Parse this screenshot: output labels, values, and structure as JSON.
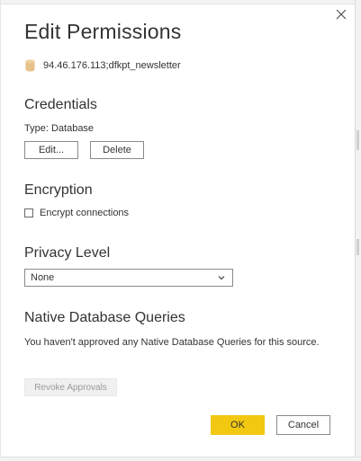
{
  "dialog": {
    "title": "Edit Permissions",
    "source_icon": "database-icon",
    "source_name": "94.46.176.113;dfkpt_newsletter",
    "close_icon": "close-icon"
  },
  "credentials": {
    "heading": "Credentials",
    "type_label": "Type: Database",
    "edit_label": "Edit...",
    "delete_label": "Delete"
  },
  "encryption": {
    "heading": "Encryption",
    "checkbox_label": "Encrypt connections",
    "checked": false
  },
  "privacy": {
    "heading": "Privacy Level",
    "selected": "None",
    "dropdown_icon": "chevron-down-icon"
  },
  "native_queries": {
    "heading": "Native Database Queries",
    "message": "You haven't approved any Native Database Queries for this source.",
    "revoke_label": "Revoke Approvals",
    "revoke_enabled": false
  },
  "footer": {
    "ok_label": "OK",
    "cancel_label": "Cancel"
  },
  "colors": {
    "accent": "#f2c811",
    "text": "#333333",
    "border": "#8a8a8a",
    "disabled_text": "#9a9a9a",
    "db_icon": "#e8c08a"
  }
}
